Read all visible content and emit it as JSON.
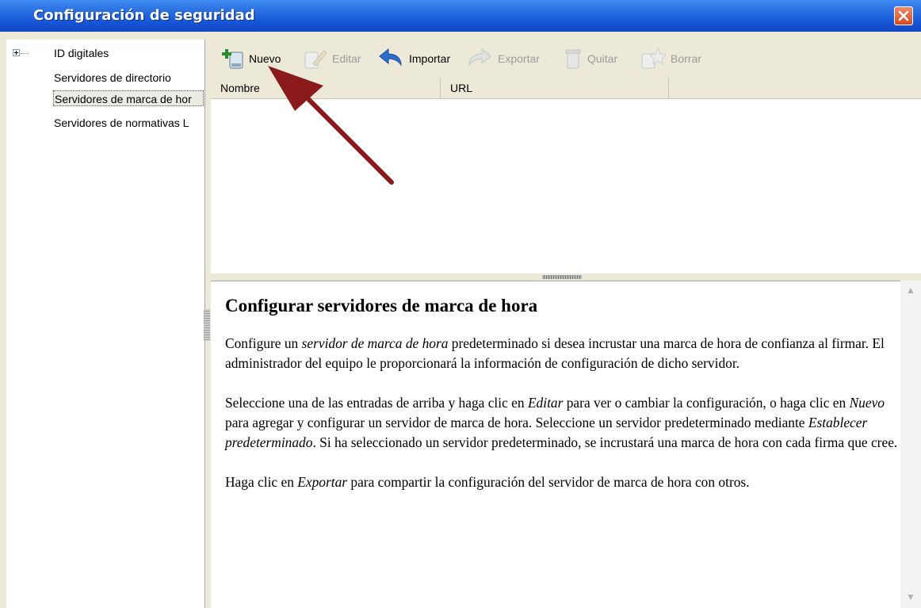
{
  "window": {
    "title": "Configuración de seguridad"
  },
  "tree": {
    "items": [
      {
        "label": "ID digitales"
      },
      {
        "label": "Servidores de directorio"
      },
      {
        "label": "Servidores de marca de hor"
      },
      {
        "label": "Servidores de normativas L"
      }
    ]
  },
  "toolbar": {
    "nuevo": "Nuevo",
    "editar": "Editar",
    "importar": "Importar",
    "exportar": "Exportar",
    "quitar": "Quitar",
    "borrar": "Borrar"
  },
  "list": {
    "columns": [
      "Nombre",
      "URL"
    ]
  },
  "help": {
    "title": "Configurar servidores de marca de hora",
    "p1": {
      "a": "Configure un ",
      "b": "servidor de marca de hora",
      "c": " predeterminado si desea incrustar una marca de hora de confianza al firmar. El administrador del equipo le proporcionará la información de configuración de dicho servidor."
    },
    "p2": {
      "a": "Seleccione una de las entradas de arriba y haga clic en ",
      "b": "Editar",
      "c": " para ver o cambiar la configuración, o haga clic en ",
      "d": "Nuevo",
      "e": " para agregar y configurar un servidor de marca de hora. Seleccione un servidor predeterminado mediante ",
      "f": "Establecer predeterminado",
      "g": ". Si ha seleccionado un servidor predeterminado, se incrustará una marca de hora con cada firma que cree."
    },
    "p3": {
      "a": "Haga clic en ",
      "b": "Exportar",
      "c": " para compartir la configuración del servidor de marca de hora con otros."
    }
  },
  "colors": {
    "titlebar": "#2a6fe0",
    "annotation_arrow": "#8b1a1a"
  }
}
